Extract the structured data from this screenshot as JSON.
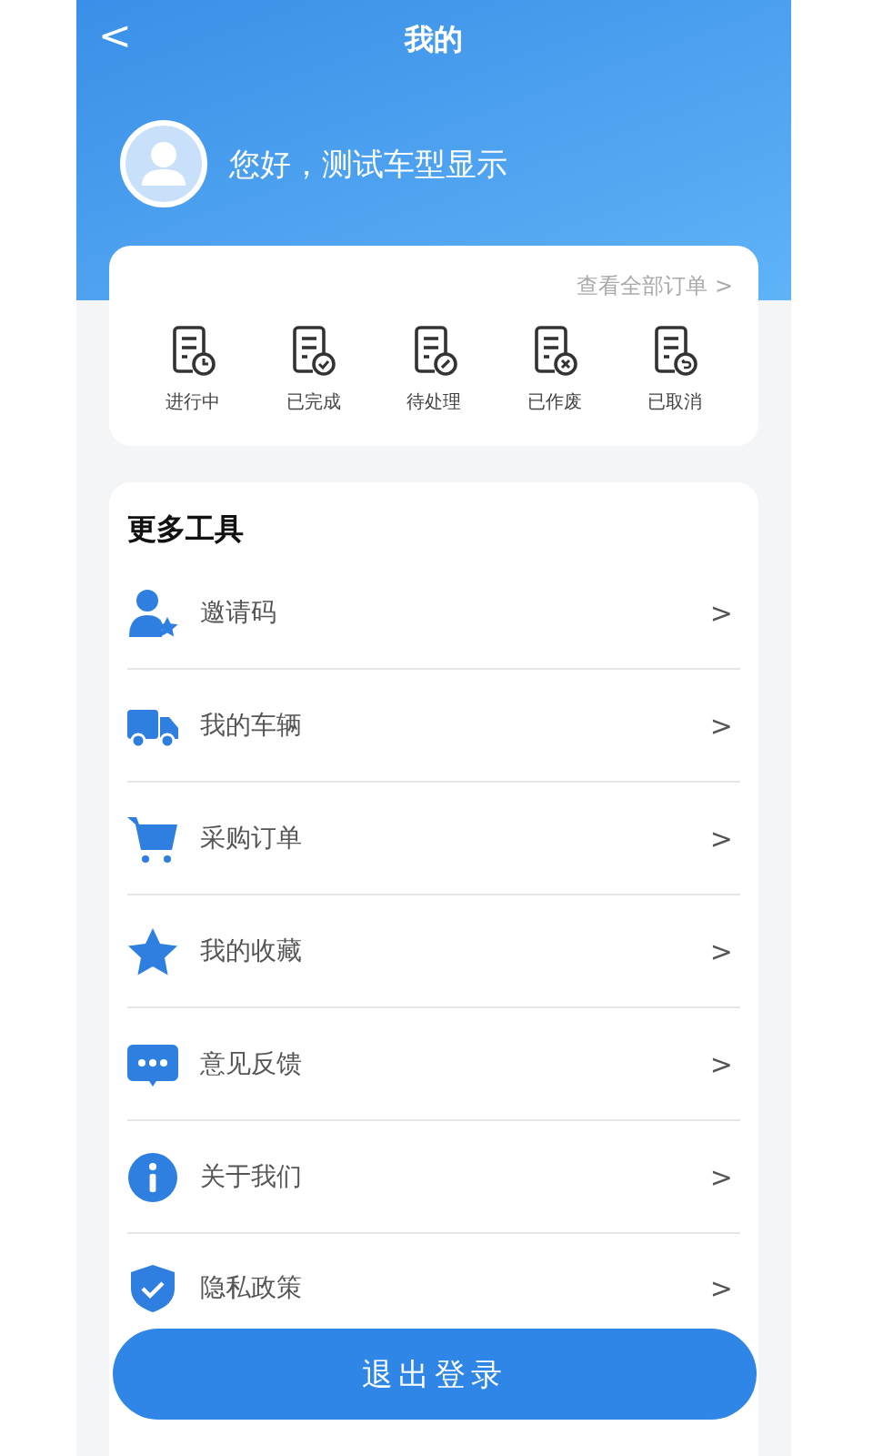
{
  "header": {
    "back": "<",
    "title": "我的",
    "greeting": "您好，测试车型显示"
  },
  "orders": {
    "view_all": "查看全部订单 >",
    "items": [
      {
        "label": "进行中",
        "kind": "clock"
      },
      {
        "label": "已完成",
        "kind": "check"
      },
      {
        "label": "待处理",
        "kind": "edit"
      },
      {
        "label": "已作废",
        "kind": "cancel"
      },
      {
        "label": "已取消",
        "kind": "undo"
      }
    ]
  },
  "tools": {
    "title": "更多工具",
    "items": [
      {
        "label": "邀请码",
        "kind": "invite",
        "arrow": ">"
      },
      {
        "label": "我的车辆",
        "kind": "truck",
        "arrow": ">"
      },
      {
        "label": "采购订单",
        "kind": "cart",
        "arrow": ">"
      },
      {
        "label": "我的收藏",
        "kind": "star",
        "arrow": ">"
      },
      {
        "label": "意见反馈",
        "kind": "chat",
        "arrow": ">"
      },
      {
        "label": "关于我们",
        "kind": "info",
        "arrow": ">"
      },
      {
        "label": "隐私政策",
        "kind": "shield",
        "arrow": ">"
      }
    ]
  },
  "logout": "退出登录"
}
